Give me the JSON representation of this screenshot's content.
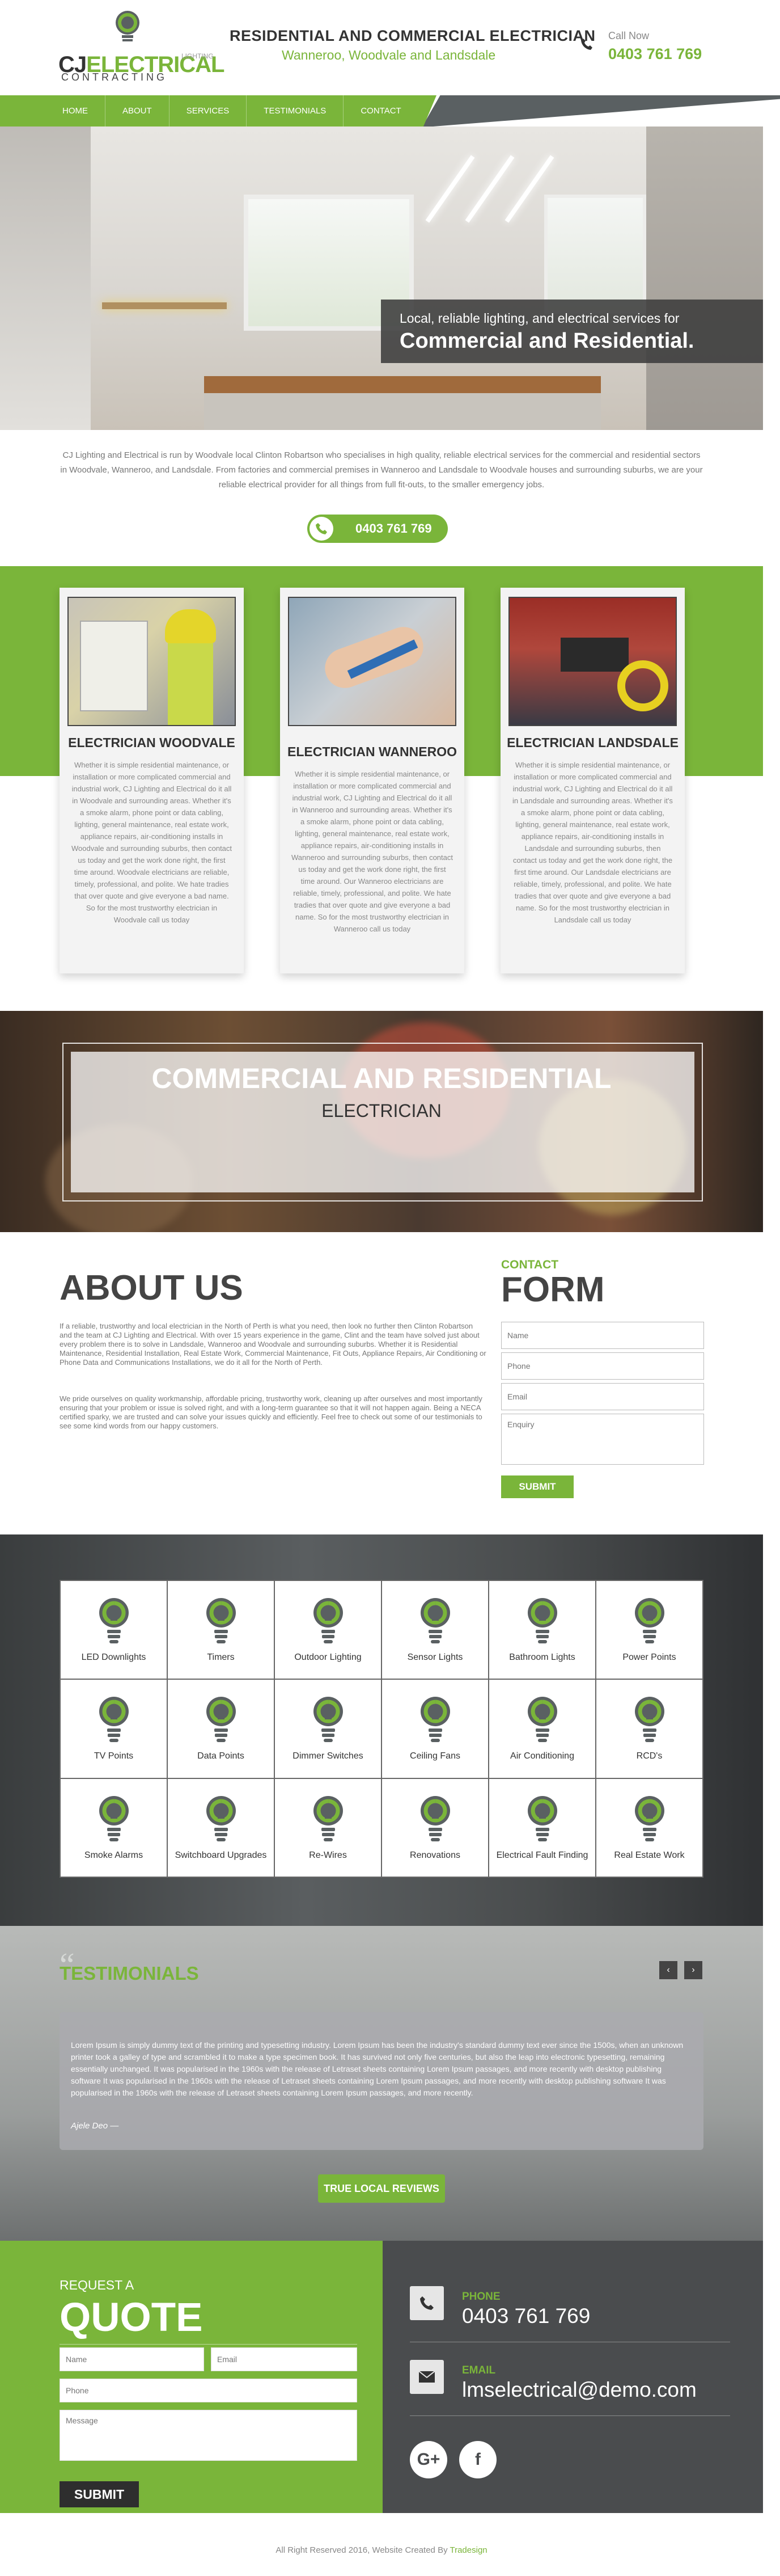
{
  "header": {
    "logo_text_part1": "CJ",
    "logo_text_part2": "ELECTRICAL",
    "logo_tagline": "CONTRACTING",
    "logo_small": "LIGHTING",
    "title": "RESIDENTIAL AND COMMERCIAL ELECTRICIAN",
    "subtitle": "Wanneroo, Woodvale and Landsdale",
    "call_now_label": "Call Now",
    "phone": "0403 761 769"
  },
  "nav": {
    "items": [
      "HOME",
      "ABOUT",
      "SERVICES",
      "TESTIMONIALS",
      "CONTACT"
    ]
  },
  "hero": {
    "line1": "Local, reliable lighting, and electrical services for",
    "line2": "Commercial and Residential."
  },
  "intro": {
    "text": "CJ Lighting and Electrical is run by Woodvale local Clinton Robartson who specialises in high quality, reliable electrical services for the commercial and residential sectors in Woodvale, Wanneroo, and Landsdale. From factories and commercial premises in Wanneroo and Landsdale to Woodvale houses and surrounding suburbs, we are your reliable electrical provider for all things from full fit-outs, to the smaller emergency jobs.",
    "phone_button": "0403 761 769"
  },
  "services": [
    {
      "title": "ELECTRICIAN WOODVALE",
      "text": "Whether it is simple residential maintenance, or installation or more complicated commercial and industrial work, CJ Lighting and Electrical do it all in Woodvale and surrounding areas. Whether it's a smoke alarm, phone point or data cabling, lighting, general maintenance, real estate work, appliance repairs, air-conditioning installs in Woodvale and surrounding suburbs, then contact us today and get the work done right, the first time around. Woodvale electricians are reliable, timely, professional, and polite. We hate tradies that over quote and give everyone a bad name. So for the most trustworthy electrician in Woodvale call us today"
    },
    {
      "title": "ELECTRICIAN WANNEROO",
      "text": "Whether it is simple residential maintenance, or installation or more complicated commercial and industrial work, CJ Lighting and Electrical do it all in Wanneroo and surrounding areas. Whether it's a smoke alarm, phone point or data cabling, lighting, general maintenance, real estate work, appliance repairs, air-conditioning installs in Wanneroo and surrounding suburbs, then contact us today and get the work done right, the first time around. Our Wanneroo electricians are reliable, timely, professional, and polite. We hate tradies that over quote and give everyone a bad name. So for the most trustworthy electrician in Wanneroo call us today"
    },
    {
      "title": "ELECTRICIAN LANDSDALE",
      "text": "Whether it is simple residential maintenance, or installation or more complicated commercial and industrial work, CJ Lighting and Electrical do it all in Landsdale and surrounding areas. Whether it's a smoke alarm, phone point or data cabling, lighting, general maintenance, real estate work, appliance repairs, air-conditioning installs in Landsdale and surrounding suburbs, then contact us today and get the work done right, the first time around. Our Landsdale electricians are reliable, timely, professional, and polite. We hate tradies that over quote and give everyone a bad name. So for the most trustworthy electrician in Landsdale call us today"
    }
  ],
  "banner": {
    "line1": "COMMERCIAL AND RESIDENTIAL",
    "line2": "ELECTRICIAN"
  },
  "about": {
    "title": "ABOUT US",
    "para1": "If a reliable, trustworthy and local electrician in the North of Perth is what you need, then look no further then Clinton Robartson and the team at CJ Lighting and Electrical. With over 15 years experience in the game, Clint and the team have solved just about every problem there is to solve in Landsdale, Wanneroo and Woodvale and surrounding suburbs. Whether it is Residential Maintenance, Residential Installation, Real Estate Work, Commercial Maintenance, Fit Outs, Appliance Repairs, Air Conditioning or Phone Data and Communications Installations, we do it all for the North of Perth.",
    "para2": "We pride ourselves on quality workmanship, affordable pricing, trustworthy work, cleaning up after ourselves and most importantly ensuring that your problem or issue is solved right, and with a long-term guarantee so that it will not happen again. Being a NECA certified sparky, we are trusted and can solve your issues quickly and efficiently. Feel free to check out some of our testimonials to see some kind words from our happy customers."
  },
  "contact_form": {
    "label_small": "CONTACT",
    "label_big": "FORM",
    "name_placeholder": "Name",
    "phone_placeholder": "Phone",
    "email_placeholder": "Email",
    "enquiry_placeholder": "Enquiry",
    "submit_label": "SUBMIT"
  },
  "service_grid": [
    "LED Downlights",
    "Timers",
    "Outdoor Lighting",
    "Sensor Lights",
    "Bathroom Lights",
    "Power Points",
    "TV Points",
    "Data Points",
    "Dimmer Switches",
    "Ceiling Fans",
    "Air Conditioning",
    "RCD's",
    "Smoke Alarms",
    "Switchboard Upgrades",
    "Re-Wires",
    "Renovations",
    "Electrical Fault Finding",
    "Real Estate Work"
  ],
  "testimonials": {
    "quote_mark": "“",
    "title": "TESTIMONIALS",
    "prev_label": "‹",
    "next_label": "›",
    "text": "Lorem Ipsum is simply dummy text of the printing and typesetting industry. Lorem Ipsum has been the industry's standard dummy text ever since the 1500s, when an unknown printer took a galley of type and scrambled it to make a type specimen book. It has survived not only five centuries, but also the leap into electronic typesetting, remaining essentially unchanged. It was popularised in the 1960s with the release of Letraset sheets containing Lorem Ipsum passages, and more recently with desktop publishing software It was popularised in the 1960s with the release of Letraset sheets containing Lorem Ipsum passages, and more recently with desktop publishing software It was popularised in the 1960s with the release of Letraset sheets containing Lorem Ipsum passages, and more recently.",
    "author": "Ajele Deo",
    "reviews_button": "TRUE LOCAL REVIEWS"
  },
  "quote": {
    "request_label": "REQUEST A",
    "title": "QUOTE",
    "name_placeholder": "Name",
    "email_placeholder": "Email",
    "phone_placeholder": "Phone",
    "message_placeholder": "Message",
    "submit_label": "SUBMIT"
  },
  "contact_info": {
    "phone_label": "PHONE",
    "phone_value": "0403 761 769",
    "email_label": "EMAIL",
    "email_value": "lmselectrical@demo.com",
    "social": [
      "G+",
      "f"
    ]
  },
  "footer": {
    "text": "All Right Reserved 2016, Website Created By",
    "credit": "Tradesign"
  },
  "colors": {
    "brand_green": "#7ab53a",
    "dark_grey": "#4a4c4e",
    "text_grey": "#777777"
  }
}
